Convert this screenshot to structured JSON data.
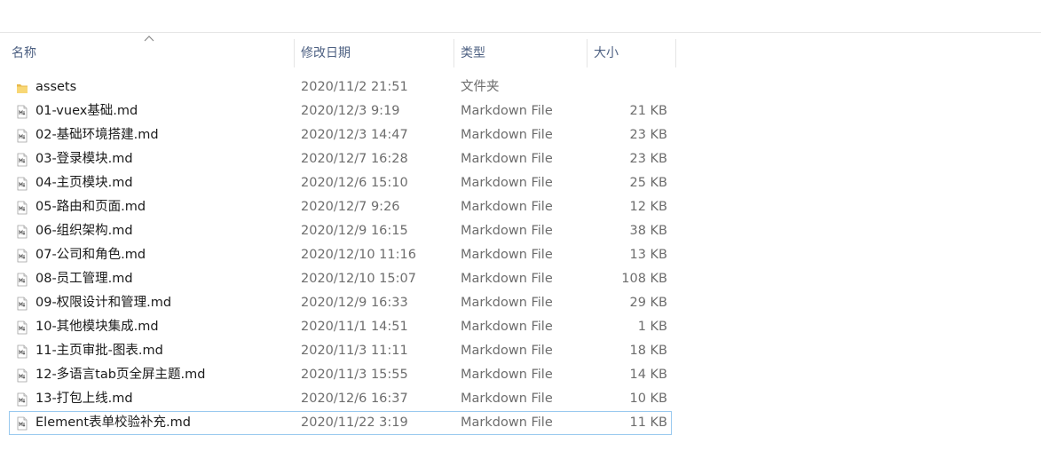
{
  "header": {
    "name": "名称",
    "date": "修改日期",
    "type": "类型",
    "size": "大小"
  },
  "files": [
    {
      "name": "assets",
      "date": "2020/11/2 21:51",
      "type": "文件夹",
      "size": "",
      "icon": "folder-icon"
    },
    {
      "name": "01-vuex基础.md",
      "date": "2020/12/3 9:19",
      "type": "Markdown File",
      "size": "21 KB",
      "icon": "markdown-file-icon"
    },
    {
      "name": "02-基础环境搭建.md",
      "date": "2020/12/3 14:47",
      "type": "Markdown File",
      "size": "23 KB",
      "icon": "markdown-file-icon"
    },
    {
      "name": "03-登录模块.md",
      "date": "2020/12/7 16:28",
      "type": "Markdown File",
      "size": "23 KB",
      "icon": "markdown-file-icon"
    },
    {
      "name": "04-主页模块.md",
      "date": "2020/12/6 15:10",
      "type": "Markdown File",
      "size": "25 KB",
      "icon": "markdown-file-icon"
    },
    {
      "name": "05-路由和页面.md",
      "date": "2020/12/7 9:26",
      "type": "Markdown File",
      "size": "12 KB",
      "icon": "markdown-file-icon"
    },
    {
      "name": "06-组织架构.md",
      "date": "2020/12/9 16:15",
      "type": "Markdown File",
      "size": "38 KB",
      "icon": "markdown-file-icon"
    },
    {
      "name": "07-公司和角色.md",
      "date": "2020/12/10 11:16",
      "type": "Markdown File",
      "size": "13 KB",
      "icon": "markdown-file-icon"
    },
    {
      "name": "08-员工管理.md",
      "date": "2020/12/10 15:07",
      "type": "Markdown File",
      "size": "108 KB",
      "icon": "markdown-file-icon"
    },
    {
      "name": "09-权限设计和管理.md",
      "date": "2020/12/9 16:33",
      "type": "Markdown File",
      "size": "29 KB",
      "icon": "markdown-file-icon"
    },
    {
      "name": "10-其他模块集成.md",
      "date": "2020/11/1 14:51",
      "type": "Markdown File",
      "size": "1 KB",
      "icon": "markdown-file-icon"
    },
    {
      "name": "11-主页审批-图表.md",
      "date": "2020/11/3 11:11",
      "type": "Markdown File",
      "size": "18 KB",
      "icon": "markdown-file-icon"
    },
    {
      "name": "12-多语言tab页全屏主题.md",
      "date": "2020/11/3 15:55",
      "type": "Markdown File",
      "size": "14 KB",
      "icon": "markdown-file-icon"
    },
    {
      "name": "13-打包上线.md",
      "date": "2020/12/6 16:37",
      "type": "Markdown File",
      "size": "10 KB",
      "icon": "markdown-file-icon"
    },
    {
      "name": "Element表单校验补充.md",
      "date": "2020/11/22 3:19",
      "type": "Markdown File",
      "size": "11 KB",
      "icon": "markdown-file-icon",
      "selected": true
    }
  ],
  "colors": {
    "header_text": "#4d6082",
    "selection_border": "#99c9ef",
    "folder": "#f8d775"
  }
}
